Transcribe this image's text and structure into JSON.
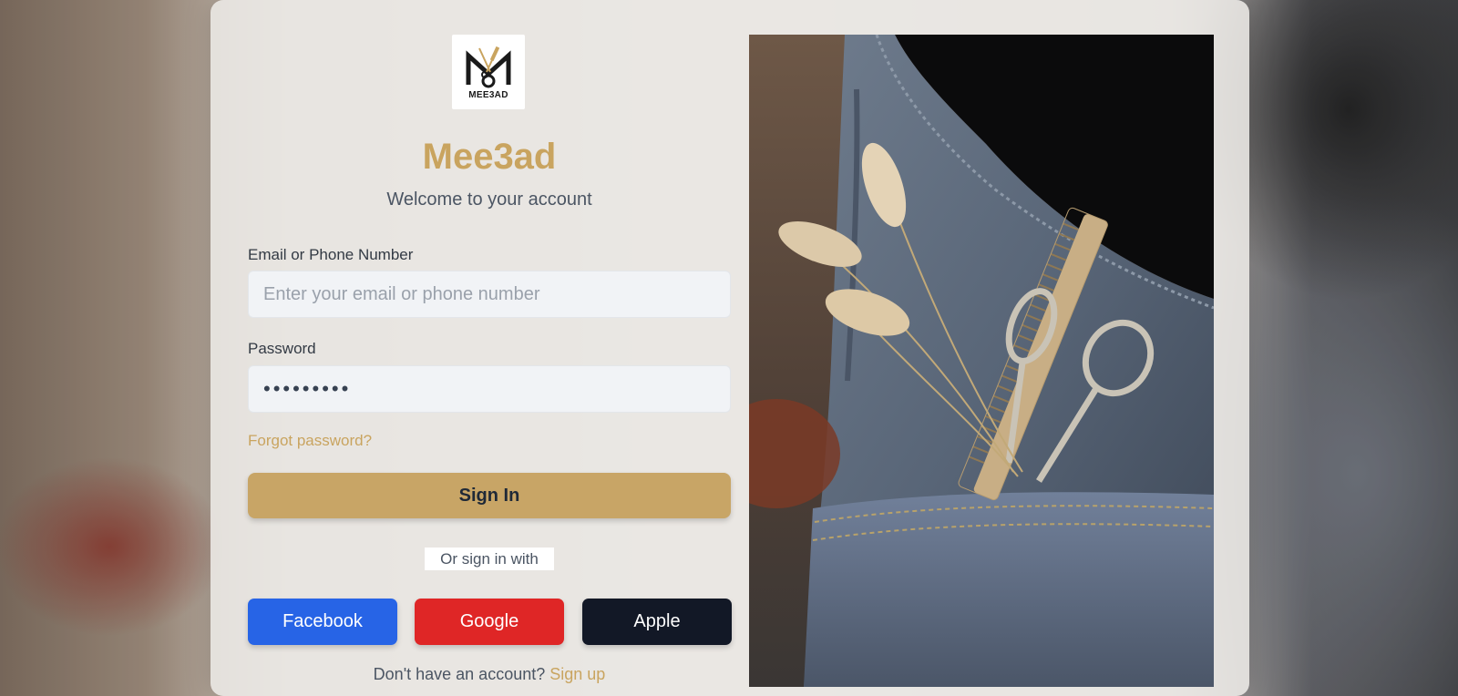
{
  "brand": {
    "name": "Mee3ad",
    "logo_text": "MEE3AD",
    "welcome": "Welcome to your account"
  },
  "form": {
    "email_label": "Email or Phone Number",
    "email_placeholder": "Enter your email or phone number",
    "password_label": "Password",
    "password_value": "•••••••••",
    "forgot_link": "Forgot password?",
    "signin_label": "Sign In"
  },
  "social": {
    "divider": "Or sign in with",
    "facebook": "Facebook",
    "google": "Google",
    "apple": "Apple"
  },
  "signup": {
    "prompt": "Don't have an account?",
    "link": "Sign up"
  },
  "colors": {
    "accent": "#c9a45f",
    "facebook": "#2764e6",
    "google": "#df2626",
    "apple": "#121826"
  },
  "hero_image": {
    "icon": "barber-tools-photo"
  }
}
